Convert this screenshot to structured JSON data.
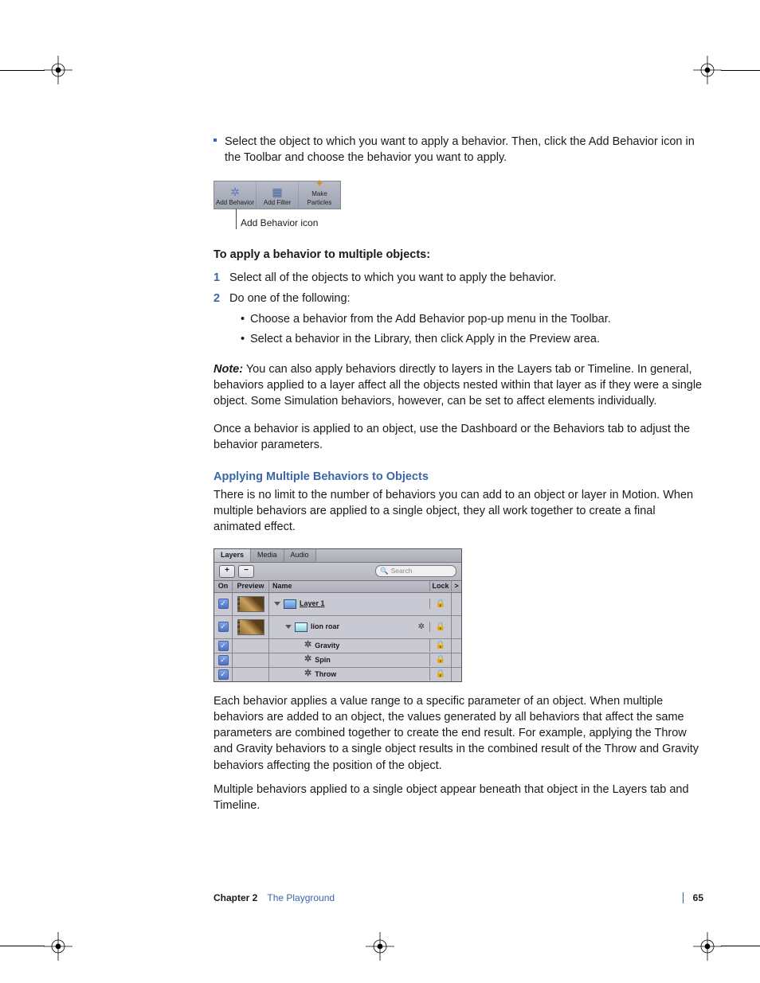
{
  "intro_bullet": "Select the object to which you want to apply a behavior. Then, click the Add Behavior icon in the Toolbar and choose the behavior you want to apply.",
  "toolbar": {
    "items": [
      "Add Behavior",
      "Add Filter",
      "Make Particles"
    ],
    "caption": "Add Behavior icon"
  },
  "multi_heading": "To apply a behavior to multiple objects:",
  "steps": [
    {
      "num": "1",
      "text": "Select all of the objects to which you want to apply the behavior."
    },
    {
      "num": "2",
      "text": "Do one of the following:"
    }
  ],
  "subitems": [
    "Choose a behavior from the Add Behavior pop-up menu in the Toolbar.",
    "Select a behavior in the Library, then click Apply in the Preview area."
  ],
  "note_label": "Note:",
  "note_body": "  You can also apply behaviors directly to layers in the Layers tab or Timeline. In general, behaviors applied to a layer affect all the objects nested within that layer as if they were a single object. Some Simulation behaviors, however, can be set to affect elements individually.",
  "after_note": "Once a behavior is applied to an object, use the Dashboard or the Behaviors tab to adjust the behavior parameters.",
  "h2": "Applying Multiple Behaviors to Objects",
  "h2_body": "There is no limit to the number of behaviors you can add to an object or layer in Motion. When multiple behaviors are applied to a single object, they all work together to create a final animated effect.",
  "layers": {
    "tabs": [
      "Layers",
      "Media",
      "Audio"
    ],
    "search_placeholder": "Search",
    "add_label": "+",
    "remove_label": "−",
    "columns": {
      "on": "On",
      "preview": "Preview",
      "name": "Name",
      "lock": "Lock",
      "more": ">"
    },
    "rows": [
      {
        "type": "layer",
        "name": "Layer 1",
        "indent": 0,
        "hasThumb": true,
        "hasGear": false
      },
      {
        "type": "image",
        "name": "lion roar",
        "indent": 1,
        "hasThumb": true,
        "hasGear": true
      },
      {
        "type": "behavior",
        "name": "Gravity",
        "indent": 2,
        "hasThumb": false,
        "hasGear": false
      },
      {
        "type": "behavior",
        "name": "Spin",
        "indent": 2,
        "hasThumb": false,
        "hasGear": false
      },
      {
        "type": "behavior",
        "name": "Throw",
        "indent": 2,
        "hasThumb": false,
        "hasGear": false
      }
    ]
  },
  "para_after_layers": "Each behavior applies a value range to a specific parameter of an object. When multiple behaviors are added to an object, the values generated by all behaviors that affect the same parameters are combined together to create the end result. For example, applying the Throw and Gravity behaviors to a single object results in the combined result of the Throw and Gravity behaviors affecting the position of the object.",
  "para_last": "Multiple behaviors applied to a single object appear beneath that object in the Layers tab and Timeline.",
  "footer": {
    "chapter": "Chapter 2",
    "title": "The Playground",
    "page": "65"
  }
}
